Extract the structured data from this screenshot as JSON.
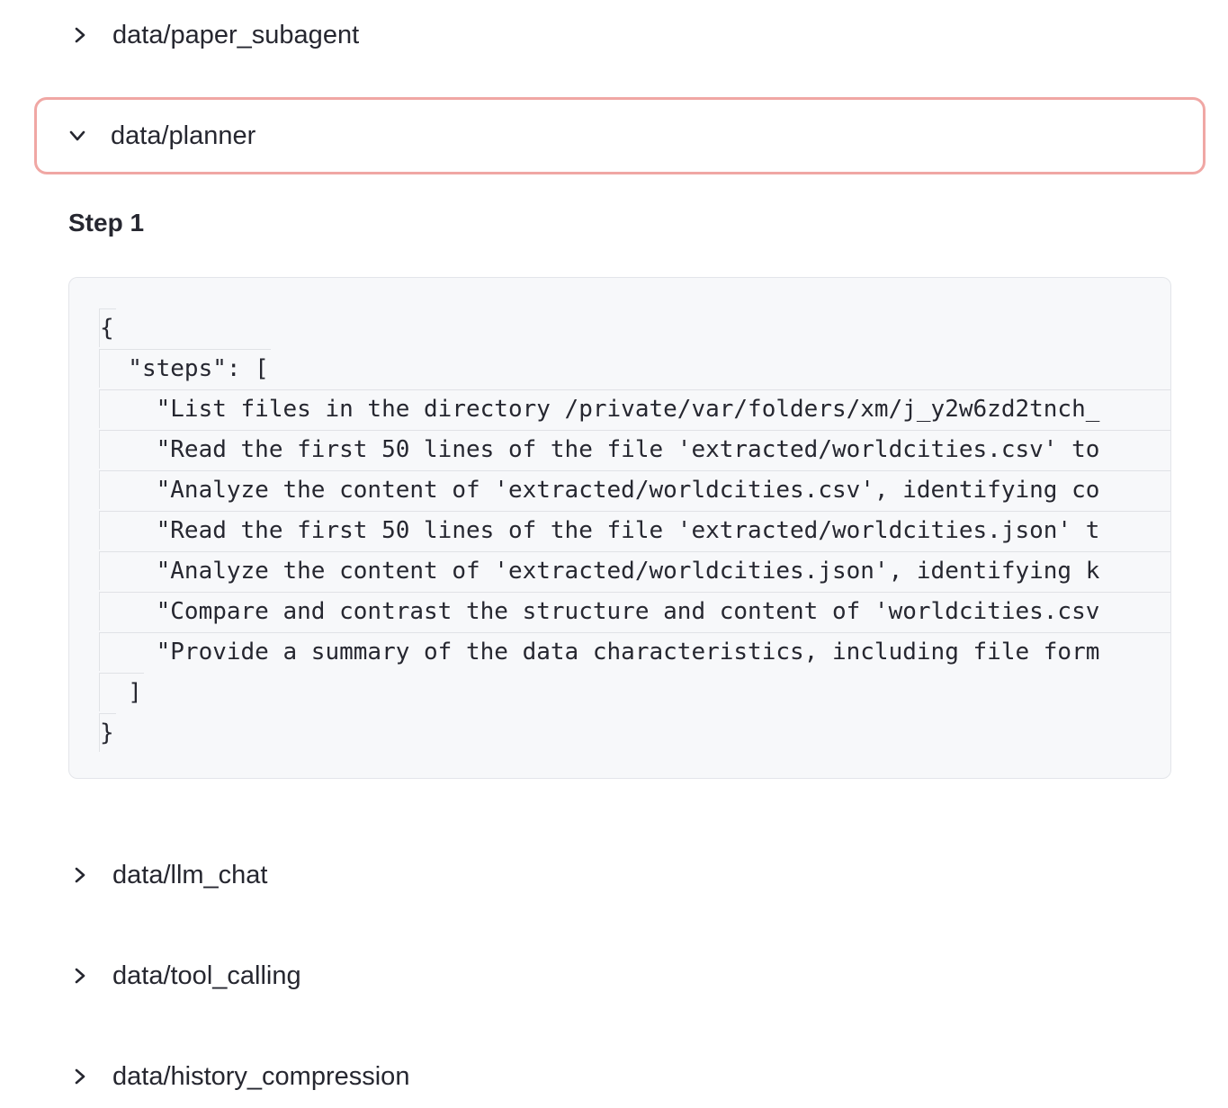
{
  "expanders": [
    {
      "label": "data/paper_subagent",
      "expanded": false
    },
    {
      "label": "data/planner",
      "expanded": true
    },
    {
      "label": "data/llm_chat",
      "expanded": false
    },
    {
      "label": "data/tool_calling",
      "expanded": false
    },
    {
      "label": "data/history_compression",
      "expanded": false
    }
  ],
  "planner": {
    "step_title": "Step 1",
    "code_lines": [
      "{",
      "  \"steps\": [",
      "    \"List files in the directory /private/var/folders/xm/j_y2w6zd2tnch_",
      "    \"Read the first 50 lines of the file 'extracted/worldcities.csv' to",
      "    \"Analyze the content of 'extracted/worldcities.csv', identifying co",
      "    \"Read the first 50 lines of the file 'extracted/worldcities.json' t",
      "    \"Analyze the content of 'extracted/worldcities.json', identifying k",
      "    \"Compare and contrast the structure and content of 'worldcities.csv",
      "    \"Provide a summary of the data characteristics, including file form",
      "  ]",
      "}"
    ]
  },
  "colors": {
    "focus_border": "#f0a7a4",
    "code_background": "#f7f8fa",
    "text": "#262730"
  },
  "icons": {
    "collapsed": "chevron-right-icon",
    "expanded": "chevron-down-icon"
  }
}
